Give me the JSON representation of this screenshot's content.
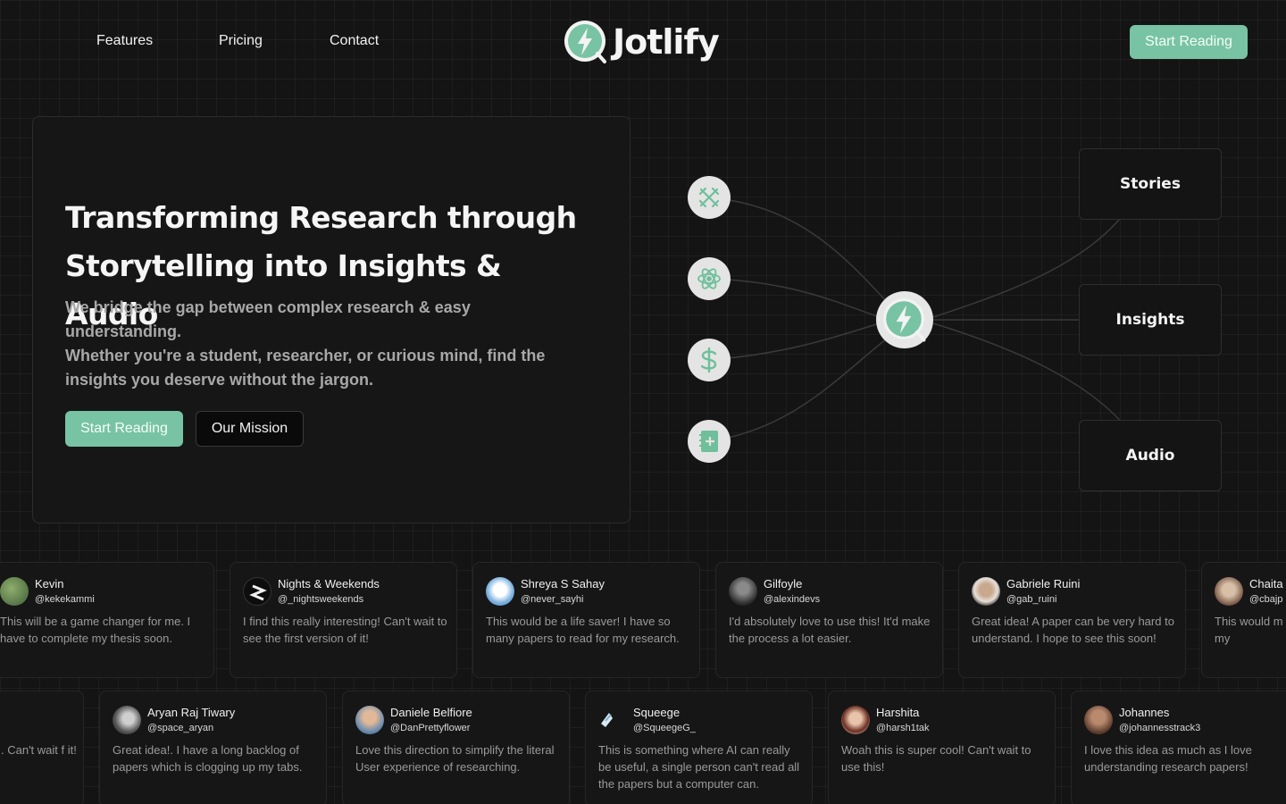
{
  "nav": {
    "links": [
      "Features",
      "Pricing",
      "Contact"
    ],
    "brand": "Jotlify",
    "cta": "Start Reading"
  },
  "colors": {
    "accent": "#78c3a3",
    "background": "#141414",
    "card": "#161616"
  },
  "hero": {
    "title": "Transforming Research through Storytelling into Insights & Audio",
    "subtitle_1": "We bridge the gap between complex research & easy understanding.",
    "subtitle_2": "Whether you're a student, researcher, or curious mind, find the insights you deserve without the jargon.",
    "primary_button": "Start Reading",
    "secondary_button": "Our Mission"
  },
  "diagram": {
    "sources": [
      "tools-icon",
      "atom-icon",
      "dollar-icon",
      "notebook-plus-icon"
    ],
    "hub": "jotlify-logo-icon",
    "outputs": [
      "Stories",
      "Insights",
      "Audio"
    ]
  },
  "testimonials": {
    "row1": [
      {
        "name": "Kevin",
        "handle": "@kekekammi",
        "text": "This will be a game changer for me. I have to complete my thesis soon."
      },
      {
        "name": "Nights & Weekends",
        "handle": "@_nightsweekends",
        "text": "I find this really interesting! Can't wait to see the first version of it!"
      },
      {
        "name": "Shreya S Sahay",
        "handle": "@never_sayhi",
        "text": "This would be a life saver! I have so many papers to read for my research."
      },
      {
        "name": "Gilfoyle",
        "handle": "@alexindevs",
        "text": "I'd absolutely love to use this! It'd make the process a lot easier."
      },
      {
        "name": "Gabriele Ruini",
        "handle": "@gab_ruini",
        "text": "Great idea! A paper can be very hard to understand. I hope to see this soon!"
      },
      {
        "name": "Chaita",
        "handle": "@cbajp",
        "text": "This would m need to go th papers for my"
      }
    ],
    "row2": [
      {
        "name": "",
        "handle": "",
        "text": ". Can't wait f it!"
      },
      {
        "name": "Aryan Raj Tiwary",
        "handle": "@space_aryan",
        "text": "Great idea!. I have a long backlog of papers which is clogging up my tabs."
      },
      {
        "name": "Daniele Belfiore",
        "handle": "@DanPrettyflower",
        "text": "Love this direction to simplify the literal User experience of researching."
      },
      {
        "name": "Squeege",
        "handle": "@SqueegeG_",
        "text": "This is something where AI can really be useful, a single person can't read all the papers but a computer can."
      },
      {
        "name": "Harshita",
        "handle": "@harsh1tak",
        "text": "Woah this is super cool! Can't wait to use this!"
      },
      {
        "name": "Johannes",
        "handle": "@johannesstrack3",
        "text": "I love this idea as much as I love understanding research papers!"
      }
    ]
  }
}
